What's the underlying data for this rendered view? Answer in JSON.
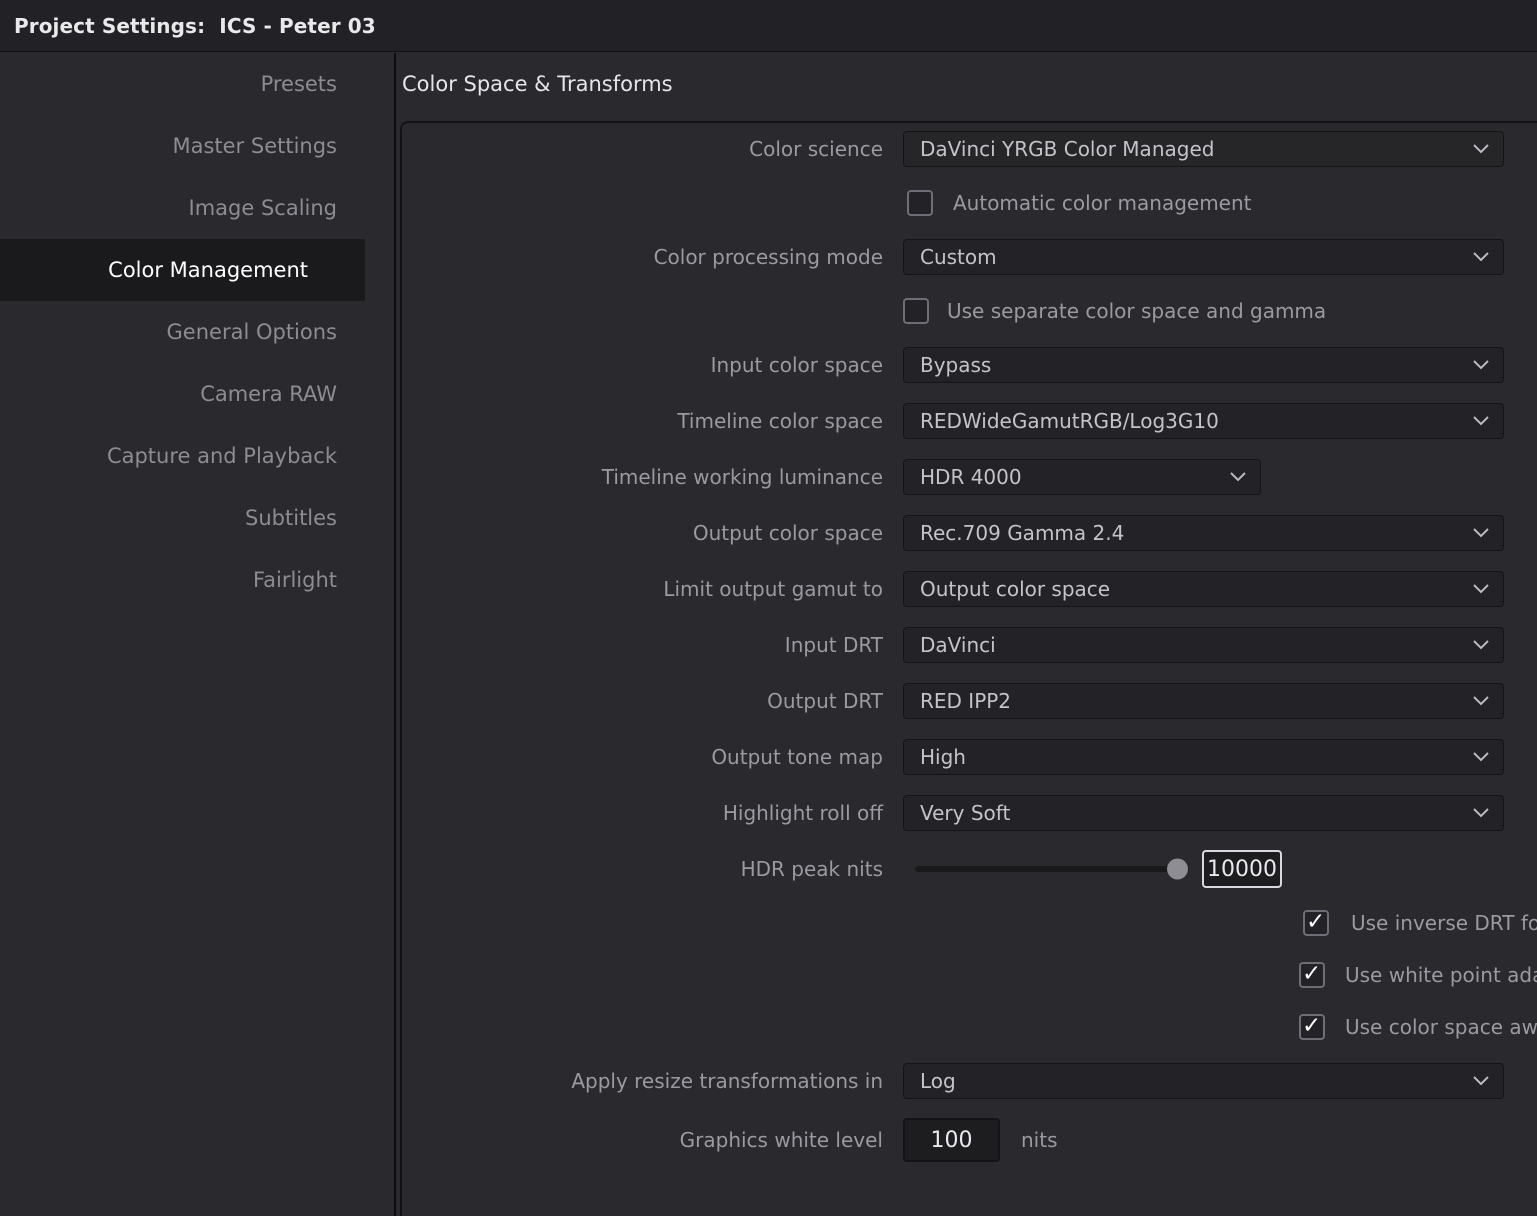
{
  "titlebar": {
    "text": "Project Settings:  ICS - Peter 03"
  },
  "sidebar": {
    "items": [
      {
        "label": "Presets",
        "selected": false
      },
      {
        "label": "Master Settings",
        "selected": false
      },
      {
        "label": "Image Scaling",
        "selected": false
      },
      {
        "label": "Color Management",
        "selected": true
      },
      {
        "label": "General Options",
        "selected": false
      },
      {
        "label": "Camera RAW",
        "selected": false
      },
      {
        "label": "Capture and Playback",
        "selected": false
      },
      {
        "label": "Subtitles",
        "selected": false
      },
      {
        "label": "Fairlight",
        "selected": false
      }
    ]
  },
  "content": {
    "section_title": "Color Space & Transforms",
    "fields": {
      "color_science": {
        "label": "Color science",
        "value": "DaVinci YRGB Color Managed"
      },
      "automatic_color_management": {
        "label": "Automatic color management",
        "checked": false
      },
      "color_processing_mode": {
        "label": "Color processing mode",
        "value": "Custom"
      },
      "use_separate_color_space_and_gamma": {
        "label": "Use separate color space and gamma",
        "checked": false
      },
      "input_color_space": {
        "label": "Input color space",
        "value": "Bypass"
      },
      "timeline_color_space": {
        "label": "Timeline color space",
        "value": "REDWideGamutRGB/Log3G10"
      },
      "timeline_working_luminance": {
        "label": "Timeline working luminance",
        "value": "HDR 4000"
      },
      "output_color_space": {
        "label": "Output color space",
        "value": "Rec.709 Gamma 2.4"
      },
      "limit_output_gamut_to": {
        "label": "Limit output gamut to",
        "value": "Output color space"
      },
      "input_drt": {
        "label": "Input DRT",
        "value": "DaVinci"
      },
      "output_drt": {
        "label": "Output DRT",
        "value": "RED IPP2"
      },
      "output_tone_map": {
        "label": "Output tone map",
        "value": "High"
      },
      "highlight_roll_off": {
        "label": "Highlight roll off",
        "value": "Very Soft"
      },
      "hdr_peak_nits": {
        "label": "HDR peak nits",
        "value": "10000",
        "slider_percent": 92
      },
      "use_inverse_drt": {
        "label": "Use inverse DRT for SDR to HDR conversion",
        "checked": true
      },
      "use_white_point_adaptation": {
        "label": "Use white point adaptation",
        "checked": true
      },
      "use_color_space_aware_grading_tools": {
        "label": "Use color space aware grading tools",
        "checked": true
      },
      "apply_resize_transformations_in": {
        "label": "Apply resize transformations in",
        "value": "Log"
      },
      "graphics_white_level": {
        "label": "Graphics white level",
        "value": "100",
        "unit": "nits"
      }
    },
    "icons": {
      "chevron": "chevron-down-icon",
      "check": "✓"
    }
  },
  "colors": {
    "background": "#29292e",
    "titlebar": "#222226",
    "selected_item": "#1a1a1c",
    "field": "#232327",
    "text_dim": "#9a9aa1",
    "text_bright": "#ffffff"
  }
}
